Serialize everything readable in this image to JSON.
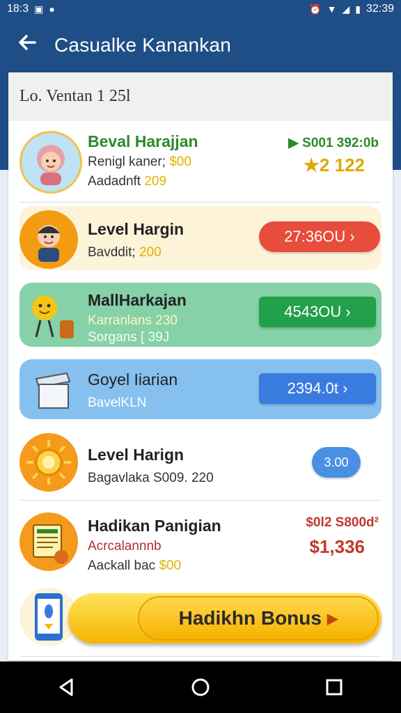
{
  "status": {
    "time_left": "18:3",
    "time_right": "32:39"
  },
  "appbar": {
    "title": "Casualke Kanankan",
    "back_icon": "arrow-left-icon"
  },
  "subheader": {
    "text": "Lo. Ventan 1 25l"
  },
  "rows": [
    {
      "name": "Beval Harajjan",
      "line1_a": "Renigl kaner; ",
      "line1_b": "$00",
      "line2_a": "Aadadnft ",
      "line2_b": "209",
      "right_top": "▶ S001 392:0b",
      "right_bottom": "★2 122"
    },
    {
      "name": "Level Hargin",
      "line1_a": "Bavddit; ",
      "line1_b": "200",
      "pill": "27:36OU ›"
    },
    {
      "name": "MallHarkajan",
      "line1": "Karranlans 230",
      "line2": "Sorgans [ 39J",
      "pill": "4543OU ›"
    },
    {
      "name": "Goyel Iiarian",
      "line1": "BavelKLN",
      "pill": "2394.0t ›"
    },
    {
      "name": "Level Harign",
      "line1": "Bagavlaka S009. 220",
      "pill": "3.00"
    },
    {
      "name": "Hadikan Panigian",
      "line1": "Acrcalannnb",
      "line2_a": "Aackall bac ",
      "line2_b": "$00",
      "right_top": "$0l2 S800d²",
      "right_bottom": "$1,336"
    }
  ],
  "bonus": {
    "label": "Hadikhn Bonus"
  },
  "colors": {
    "appbar": "#1f4e86",
    "red_pill": "#e74c3c",
    "green_pill": "#22a04a",
    "blue_pill": "#3a7be0"
  }
}
